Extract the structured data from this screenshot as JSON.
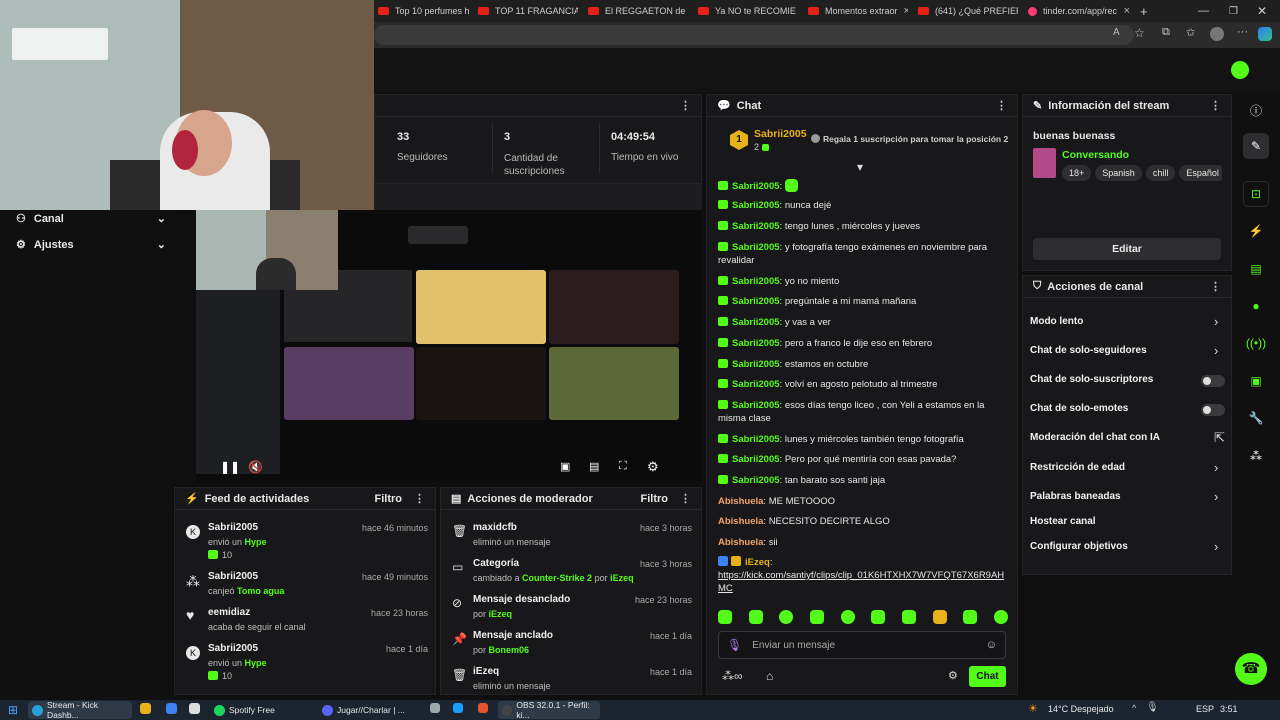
{
  "browser_tabs": [
    {
      "label": "Top 10 perfumes h"
    },
    {
      "label": "TOP 11 FRAGANCIA"
    },
    {
      "label": "El REGGAETON de"
    },
    {
      "label": "Ya NO te RECOMIE"
    },
    {
      "label": "Momentos extraor"
    },
    {
      "label": "(641) ¿Qué PREFIER"
    },
    {
      "label": "tinder.com/app/rec"
    }
  ],
  "stats": {
    "seguidores_value": "33",
    "seguidores_label": "Seguidores",
    "subs_value": "3",
    "subs_label": "Cantidad de suscripciones",
    "time_value": "04:49:54",
    "time_label": "Tiempo en vivo"
  },
  "sidebar": {
    "canal": "Canal",
    "ajustes": "Ajustes"
  },
  "chat": {
    "title": "Chat",
    "pinned_user": "Sabrii2005",
    "pinned_rank": "1",
    "pinned_count": "2",
    "gift_text": "Regala 1 suscripción para tomar la posición 2",
    "messages": [
      {
        "user": "Sabrii2005",
        "text": ""
      },
      {
        "user": "Sabrii2005",
        "text": "nunca dejé"
      },
      {
        "user": "Sabrii2005",
        "text": "tengo lunes , miércoles y jueves"
      },
      {
        "user": "Sabrii2005",
        "text": "y fotografía tengo exámenes en noviembre para revalidar"
      },
      {
        "user": "Sabrii2005",
        "text": "yo no miento"
      },
      {
        "user": "Sabrii2005",
        "text": "pregúntale a mi mamá mañana"
      },
      {
        "user": "Sabrii2005",
        "text": "y vas a ver"
      },
      {
        "user": "Sabrii2005",
        "text": "pero a franco le dije eso en febrero"
      },
      {
        "user": "Sabrii2005",
        "text": "estamos en octubre"
      },
      {
        "user": "Sabrii2005",
        "text": "volví en agosto pelotudo al trimestre"
      },
      {
        "user": "Sabrii2005",
        "text": "esos días tengo liceo , con Yeli a estamos en la misma clase"
      },
      {
        "user": "Sabrii2005",
        "text": "lunes y miércoles también tengo fotografía"
      },
      {
        "user": "Sabrii2005",
        "text": "Pero por qué mentiría con esas pavada?"
      },
      {
        "user": "Sabrii2005",
        "text": "tan barato sos santi jaja"
      },
      {
        "user": "Abishuela",
        "text": "ME METOOOO"
      },
      {
        "user": "Abishuela",
        "text": "NECESITO DECIRTE ALGO"
      },
      {
        "user": "Abishuela",
        "text": "sii"
      }
    ],
    "link_user": "iEzeq",
    "link_text": "https://kick.com/santiyf/clips/clip_01K6HTXHX7W7VFQT67X6R9AHMC",
    "input_placeholder": "Enviar un mensaje",
    "send_label": "Chat"
  },
  "stream_info": {
    "title": "Información del stream",
    "stream_title": "buenas buenass",
    "category": "Conversando",
    "tags": [
      "18+",
      "Spanish",
      "chill",
      "Español"
    ],
    "edit_label": "Editar"
  },
  "channel_actions": {
    "title": "Acciones de canal",
    "items": [
      {
        "label": "Modo lento",
        "control": "chevron"
      },
      {
        "label": "Chat de solo-seguidores",
        "control": "chevron"
      },
      {
        "label": "Chat de solo-suscriptores",
        "control": "toggle"
      },
      {
        "label": "Chat de solo-emotes",
        "control": "toggle"
      },
      {
        "label": "Moderación del chat con IA",
        "control": "external"
      },
      {
        "label": "Restricción de edad",
        "control": "chevron"
      },
      {
        "label": "Palabras baneadas",
        "control": "chevron"
      },
      {
        "label": "Hostear canal",
        "control": "none"
      },
      {
        "label": "Configurar objetivos",
        "control": "chevron"
      }
    ]
  },
  "activity": {
    "title": "Feed de actividades",
    "filter": "Filtro",
    "items": [
      {
        "name": "Sabrii2005",
        "time": "hace 46 minutos",
        "pre": "envió un",
        "hl": "Hype",
        "amount": "10",
        "icon": "kick-icon"
      },
      {
        "name": "Sabrii2005",
        "time": "hace 49 minutos",
        "pre": "canjeó",
        "hl": "Tomo agua",
        "amount": "",
        "icon": "points-icon"
      },
      {
        "name": "eemidiaz",
        "time": "hace 23 horas",
        "pre": "acaba de seguir el canal",
        "hl": "",
        "amount": "",
        "icon": "heart-icon"
      },
      {
        "name": "Sabrii2005",
        "time": "hace 1 día",
        "pre": "envió un",
        "hl": "Hype",
        "amount": "10",
        "icon": "kick-icon"
      }
    ]
  },
  "mod": {
    "title": "Acciones de moderador",
    "filter": "Filtro",
    "items": [
      {
        "name": "maxidcfb",
        "time": "hace 3 horas",
        "pre": "eliminó un mensaje",
        "hl": "",
        "post": "",
        "icon": "trash-icon"
      },
      {
        "name": "Categoría",
        "time": "hace 3 horas",
        "pre": "cambiado a",
        "hl": "Counter-Strike 2",
        "post": "por",
        "by": "iEzeq",
        "icon": "category-icon"
      },
      {
        "name": "Mensaje desanclado",
        "time": "hace 23 horas",
        "pre": "por",
        "hl": "iEzeq",
        "post": "",
        "icon": "unpin-icon"
      },
      {
        "name": "Mensaje anclado",
        "time": "hace 1 día",
        "pre": "por",
        "hl": "Bonem06",
        "post": "",
        "icon": "pin-icon"
      },
      {
        "name": "iEzeq",
        "time": "hace 1 día",
        "pre": "eliminó un mensaje",
        "hl": "",
        "post": "",
        "icon": "trash-icon"
      }
    ]
  },
  "taskbar": {
    "items": [
      "Stream - Kick Dashb...",
      "Spotify Free",
      "Jugar//Charlar | ...",
      "OBS 32.0.1 - Perfil: ki..."
    ],
    "weather": "14°C Despejado",
    "lang": "ESP",
    "clock": "3:51"
  },
  "colors": {
    "accent": "#53fc18",
    "bg": "#0f0f10",
    "panel": "#18181a"
  }
}
